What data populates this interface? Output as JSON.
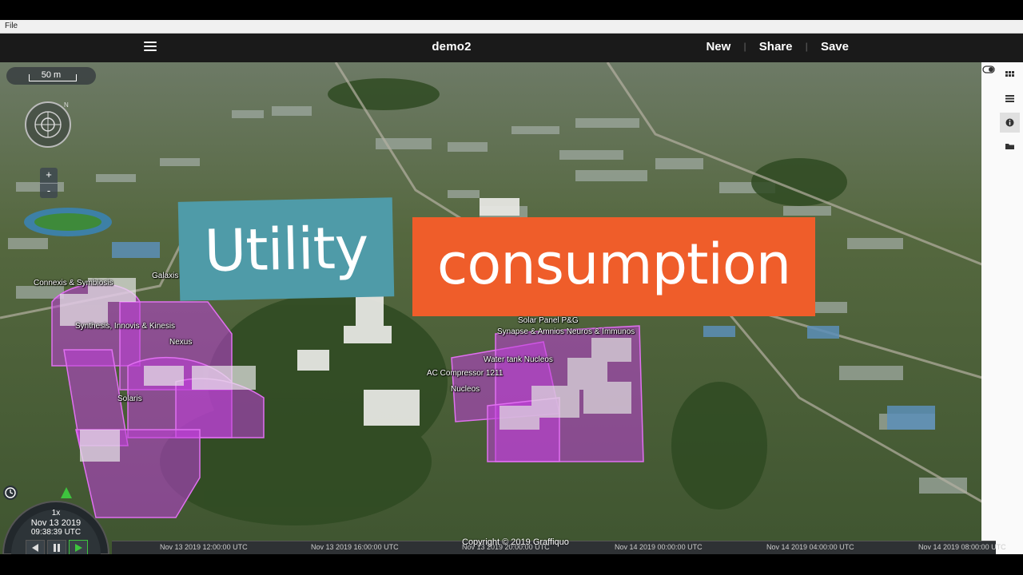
{
  "menubar": {
    "file": "File"
  },
  "appbar": {
    "title": "demo2",
    "new": "New",
    "share": "Share",
    "save": "Save"
  },
  "map": {
    "scale": "50 m",
    "zoom_in": "+",
    "zoom_out": "-",
    "copyright": "Copyright © 2019 Graffiquo"
  },
  "overlay": {
    "title_left": "Utility",
    "title_right": "consumption"
  },
  "labels": [
    "Connexis & Symbiosis",
    "Galaxis",
    "Synthesis, Innovis & Kinesis",
    "Nexus",
    "Solaris",
    "Solar Panel P&G",
    "Synapse & Amnios Neuros & Immunos",
    "Water tank Nucleos",
    "AC Compressor 1211",
    "Nucleos"
  ],
  "clock": {
    "speed": "1x",
    "date": "Nov 13 2019",
    "time": "09:38:39 UTC"
  },
  "timeline": {
    "ticks": [
      "Nov 13 2019 12:00:00 UTC",
      "Nov 13 2019 16:00:00 UTC",
      "Nov 13 2019 20:00:00 UTC",
      "Nov 14 2019 00:00:00 UTC",
      "Nov 14 2019 04:00:00 UTC",
      "Nov 14 2019 08:00:00 UTC"
    ]
  },
  "colors": {
    "teal_card": "#4f9ba8",
    "orange_card": "#ef5d2a",
    "building_highlight": "#c040d8"
  },
  "icons": [
    "menu-icon",
    "compass-icon",
    "clock-icon",
    "rewind-icon",
    "pause-icon",
    "play-icon",
    "grid-icon",
    "list-icon",
    "info-icon",
    "folder-icon",
    "toggle-icon"
  ]
}
